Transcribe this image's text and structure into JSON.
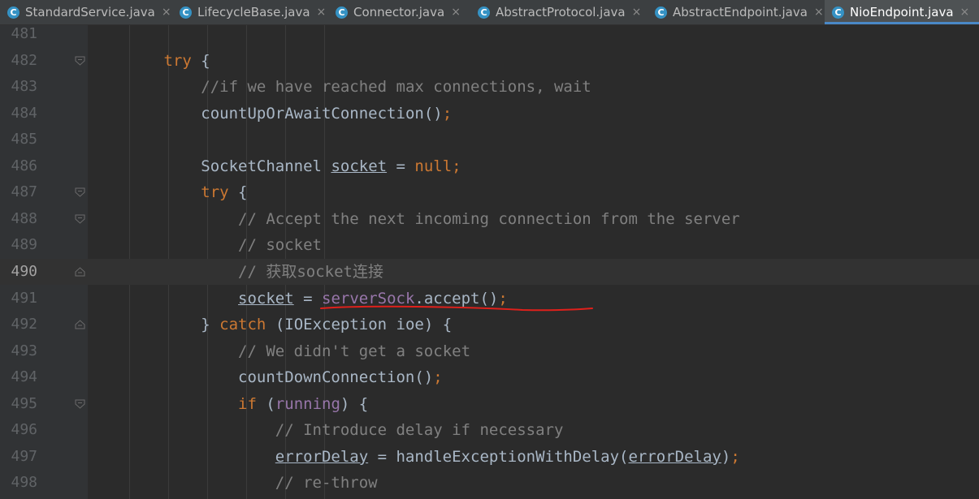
{
  "tabs": [
    {
      "label": "StandardService.java",
      "icon": "C",
      "active": false
    },
    {
      "label": "LifecycleBase.java",
      "icon": "C",
      "active": false
    },
    {
      "label": "Connector.java",
      "icon": "C",
      "active": false
    },
    {
      "label": "AbstractProtocol.java",
      "icon": "C",
      "active": false
    },
    {
      "label": "AbstractEndpoint.java",
      "icon": "C",
      "active": false
    },
    {
      "label": "NioEndpoint.java",
      "icon": "C",
      "active": true
    }
  ],
  "close_glyph": "×",
  "caret_line": 490,
  "colors": {
    "background": "#2b2b2b",
    "keyword": "#cc7832",
    "comment": "#808080",
    "field": "#9876aa",
    "text": "#a9b7c6",
    "annotation": "#e0201b",
    "active_tab_accent": "#4a88c7"
  },
  "lines": [
    {
      "num": "481",
      "indent": "",
      "tokens": []
    },
    {
      "num": "482",
      "indent": "        ",
      "fold": "open",
      "tokens": [
        {
          "t": "try",
          "c": "kw"
        },
        {
          "t": " {"
        }
      ]
    },
    {
      "num": "483",
      "indent": "            ",
      "tokens": [
        {
          "t": "//if we have reached max connections, wait",
          "c": "cm"
        }
      ]
    },
    {
      "num": "484",
      "indent": "            ",
      "tokens": [
        {
          "t": "countUpOrAwaitConnection()"
        },
        {
          "t": ";",
          "c": "kw"
        }
      ]
    },
    {
      "num": "485",
      "indent": "",
      "tokens": []
    },
    {
      "num": "486",
      "indent": "            ",
      "tokens": [
        {
          "t": "SocketChannel "
        },
        {
          "t": "socket",
          "c": "ul"
        },
        {
          "t": " = "
        },
        {
          "t": "null",
          "c": "kw"
        },
        {
          "t": ";",
          "c": "kw"
        }
      ]
    },
    {
      "num": "487",
      "indent": "            ",
      "fold": "open",
      "tokens": [
        {
          "t": "try",
          "c": "kw"
        },
        {
          "t": " {"
        }
      ]
    },
    {
      "num": "488",
      "indent": "                ",
      "fold": "open",
      "tokens": [
        {
          "t": "// Accept the next incoming connection from the server",
          "c": "cm"
        }
      ]
    },
    {
      "num": "489",
      "indent": "                ",
      "tokens": [
        {
          "t": "// socket",
          "c": "cm"
        }
      ]
    },
    {
      "num": "490",
      "indent": "                ",
      "fold": "end",
      "tokens": [
        {
          "t": "// 获取socket连接",
          "c": "cm"
        }
      ]
    },
    {
      "num": "491",
      "indent": "                ",
      "tokens": [
        {
          "t": "socket",
          "c": "ul"
        },
        {
          "t": " = "
        },
        {
          "t": "serverSock",
          "c": "fld"
        },
        {
          "t": ".accept()"
        },
        {
          "t": ";",
          "c": "kw"
        }
      ]
    },
    {
      "num": "492",
      "indent": "            ",
      "fold": "end",
      "tokens": [
        {
          "t": "} "
        },
        {
          "t": "catch",
          "c": "kw"
        },
        {
          "t": " (IOException ioe) {"
        }
      ]
    },
    {
      "num": "493",
      "indent": "                ",
      "tokens": [
        {
          "t": "// We didn't get a socket",
          "c": "cm"
        }
      ]
    },
    {
      "num": "494",
      "indent": "                ",
      "tokens": [
        {
          "t": "countDownConnection()"
        },
        {
          "t": ";",
          "c": "kw"
        }
      ]
    },
    {
      "num": "495",
      "indent": "                ",
      "fold": "open",
      "tokens": [
        {
          "t": "if",
          "c": "kw"
        },
        {
          "t": " ("
        },
        {
          "t": "running",
          "c": "fld"
        },
        {
          "t": ") {"
        }
      ]
    },
    {
      "num": "496",
      "indent": "                    ",
      "tokens": [
        {
          "t": "// Introduce delay if necessary",
          "c": "cm"
        }
      ]
    },
    {
      "num": "497",
      "indent": "                    ",
      "tokens": [
        {
          "t": "errorDelay",
          "c": "ul"
        },
        {
          "t": " = handleExceptionWithDelay("
        },
        {
          "t": "errorDelay",
          "c": "ul"
        },
        {
          "t": ")"
        },
        {
          "t": ";",
          "c": "kw"
        }
      ]
    },
    {
      "num": "498",
      "indent": "                    ",
      "tokens": [
        {
          "t": "// re-throw",
          "c": "cm"
        }
      ]
    }
  ]
}
